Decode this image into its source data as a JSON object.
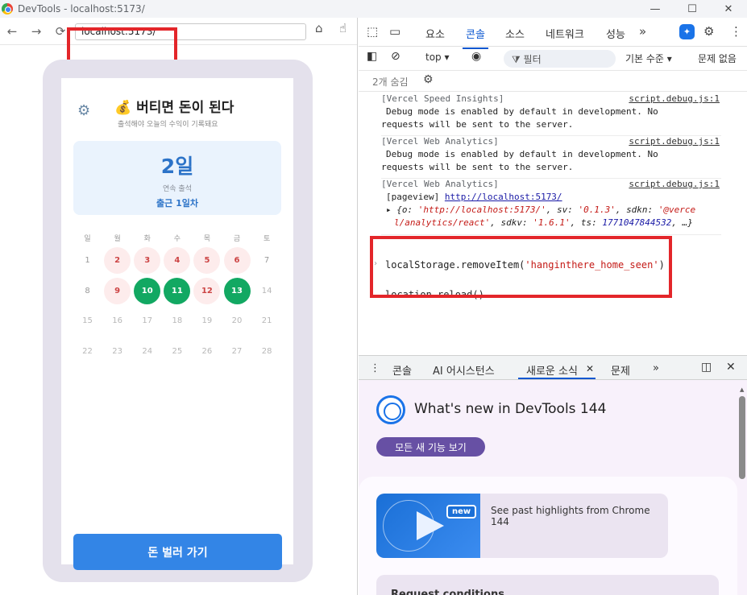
{
  "window": {
    "title": "DevTools - localhost:5173/"
  },
  "browser": {
    "url": "localhost:5173/",
    "nav": {
      "back": "←",
      "forward": "→",
      "reload": "⟳"
    }
  },
  "app": {
    "title": "💰 버티면 돈이 된다",
    "subtitle": "출석해야 오늘의 수익이 기록돼요",
    "streak_value": "2일",
    "streak_label": "연속 출석",
    "streak_day": "출근 1일차",
    "weekdays": [
      "일",
      "월",
      "화",
      "수",
      "목",
      "금",
      "토"
    ],
    "weeks": [
      [
        {
          "d": "1",
          "s": "plain"
        },
        {
          "d": "2",
          "s": "missed"
        },
        {
          "d": "3",
          "s": "missed"
        },
        {
          "d": "4",
          "s": "missed"
        },
        {
          "d": "5",
          "s": "missed"
        },
        {
          "d": "6",
          "s": "missed"
        },
        {
          "d": "7",
          "s": "plain"
        }
      ],
      [
        {
          "d": "8",
          "s": "plain"
        },
        {
          "d": "9",
          "s": "missed"
        },
        {
          "d": "10",
          "s": "done"
        },
        {
          "d": "11",
          "s": "done"
        },
        {
          "d": "12",
          "s": "missed"
        },
        {
          "d": "13",
          "s": "done"
        },
        {
          "d": "14",
          "s": "future"
        }
      ],
      [
        {
          "d": "15",
          "s": "future"
        },
        {
          "d": "16",
          "s": "future"
        },
        {
          "d": "17",
          "s": "future"
        },
        {
          "d": "18",
          "s": "future"
        },
        {
          "d": "19",
          "s": "future"
        },
        {
          "d": "20",
          "s": "future"
        },
        {
          "d": "21",
          "s": "future"
        }
      ],
      [
        {
          "d": "22",
          "s": "future"
        },
        {
          "d": "23",
          "s": "future"
        },
        {
          "d": "24",
          "s": "future"
        },
        {
          "d": "25",
          "s": "future"
        },
        {
          "d": "26",
          "s": "future"
        },
        {
          "d": "27",
          "s": "future"
        },
        {
          "d": "28",
          "s": "future"
        }
      ]
    ],
    "cta": "돈 벌러 가기"
  },
  "devtools": {
    "tabs": [
      "요소",
      "콘솔",
      "소스",
      "네트워크",
      "성능"
    ],
    "active_tab": "콘솔",
    "toolbar": {
      "context": "top ▾",
      "filter": "필터",
      "levels": "기본 수준 ▾",
      "issues": "문제 없음"
    },
    "hidden": "2개 숨김",
    "messages": [
      {
        "tag": "[Vercel Speed Insights]",
        "src": "script.debug.js:1",
        "lines": [
          "Debug mode is enabled by default in development. No",
          "requests will be sent to the server."
        ]
      },
      {
        "tag": "[Vercel Web Analytics]",
        "src": "script.debug.js:1",
        "lines": [
          "Debug mode is enabled by default in development. No",
          "requests will be sent to the server."
        ]
      },
      {
        "tag": "[Vercel Web Analytics]",
        "src": "script.debug.js:1",
        "pageview_label": "[pageview]",
        "pageview_url": "http://localhost:5173/"
      }
    ],
    "object_line1": {
      "k1": "o",
      "v1": "'http://localhost:5173/'",
      "k2": "sv",
      "v2": "'0.1.3'",
      "k3": "sdkn",
      "v3": "'@verce"
    },
    "object_line2": {
      "v3b": "l/analytics/react'",
      "k4": "sdkv",
      "v4": "'1.6.1'",
      "k5": "ts",
      "v5": "1771047844532",
      "tail": "…}"
    },
    "command_fn": "localStorage.removeItem(",
    "command_arg": "'hanginthere_home_seen'",
    "command_end": ")",
    "command2": "location.reload()",
    "drawer_tabs": {
      "console": "콘솔",
      "ai": "AI 어시스턴스",
      "whatsnew": "새로운 소식",
      "issues": "문제"
    },
    "whatsnew": {
      "title": "What's new in DevTools 144",
      "button": "모든 새 기능 보기",
      "badge": "new",
      "highlight": "See past highlights from Chrome 144",
      "next_card": "Request conditions"
    }
  }
}
